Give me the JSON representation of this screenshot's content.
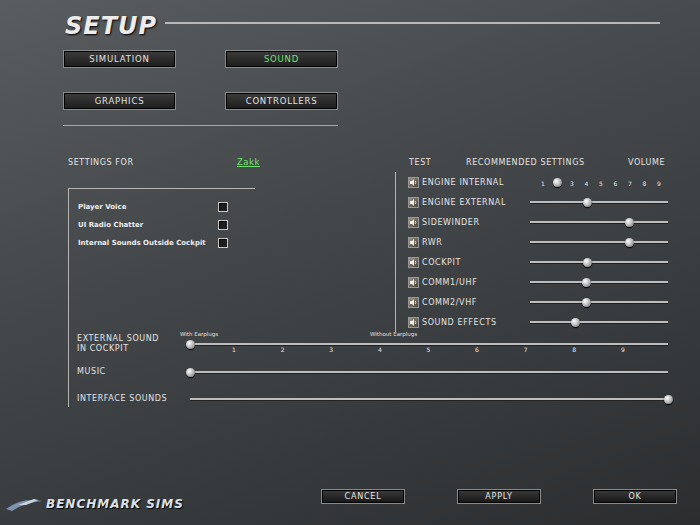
{
  "window": {
    "title": "SETUP"
  },
  "tabs": [
    {
      "label": "SIMULATION",
      "selected": false
    },
    {
      "label": "SOUND",
      "selected": true
    },
    {
      "label": "GRAPHICS",
      "selected": false
    },
    {
      "label": "CONTROLLERS",
      "selected": false
    }
  ],
  "settings_for": {
    "label": "SETTINGS FOR",
    "pilot": "Zakk"
  },
  "options": [
    {
      "label": "Player Voice",
      "checked": false
    },
    {
      "label": "UI Radio Chatter",
      "checked": false
    },
    {
      "label": "Internal Sounds Outside Cockpit",
      "checked": false
    }
  ],
  "mixer": {
    "columns": [
      "TEST",
      "RECOMMENDED SETTINGS",
      "VOLUME"
    ],
    "channels": [
      {
        "name": "ENGINE INTERNAL",
        "level": 0.2,
        "ticks": [
          "1",
          "3",
          "4",
          "5",
          "6",
          "7",
          "8",
          "9"
        ]
      },
      {
        "name": "ENGINE EXTERNAL",
        "level": 0.42
      },
      {
        "name": "SIDEWINDER",
        "level": 0.72
      },
      {
        "name": "RWR",
        "level": 0.72
      },
      {
        "name": "COCKPIT",
        "level": 0.42
      },
      {
        "name": "COMM1/UHF",
        "level": 0.41
      },
      {
        "name": "COMM2/VHF",
        "level": 0.41
      },
      {
        "name": "SOUND EFFECTS",
        "level": 0.33
      }
    ]
  },
  "global_sliders": [
    {
      "name": "EXTERNAL SOUND IN COCKPIT",
      "kind": "scaled",
      "level": 0,
      "scale_labels": [
        "With Earplugs",
        "Without Earplugs"
      ],
      "ticks": [
        "1",
        "2",
        "3",
        "4",
        "5",
        "6",
        "7",
        "8",
        "9"
      ]
    },
    {
      "name": "MUSIC",
      "kind": "plain",
      "level": 0
    },
    {
      "name": "INTERFACE SOUNDS",
      "kind": "plain",
      "level": 1
    }
  ],
  "buttons": [
    "CANCEL",
    "APPLY",
    "OK"
  ],
  "logo": "BENCHMARK SIMS"
}
